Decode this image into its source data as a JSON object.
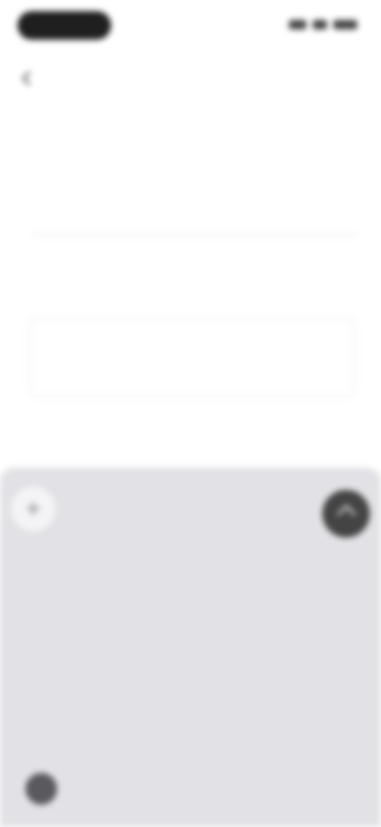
{
  "nav": {
    "breadcrumb": "",
    "more": ""
  },
  "page": {
    "title": "",
    "subtitle": ""
  },
  "row": {
    "label": "",
    "value": ""
  },
  "body_text": "",
  "sheet": {
    "input_placeholder": "",
    "heading": "",
    "caption": ""
  },
  "icons": {
    "back": "chevron-left-icon",
    "add": "plus-icon",
    "send": "send-icon",
    "bottom": "avatar-icon"
  }
}
